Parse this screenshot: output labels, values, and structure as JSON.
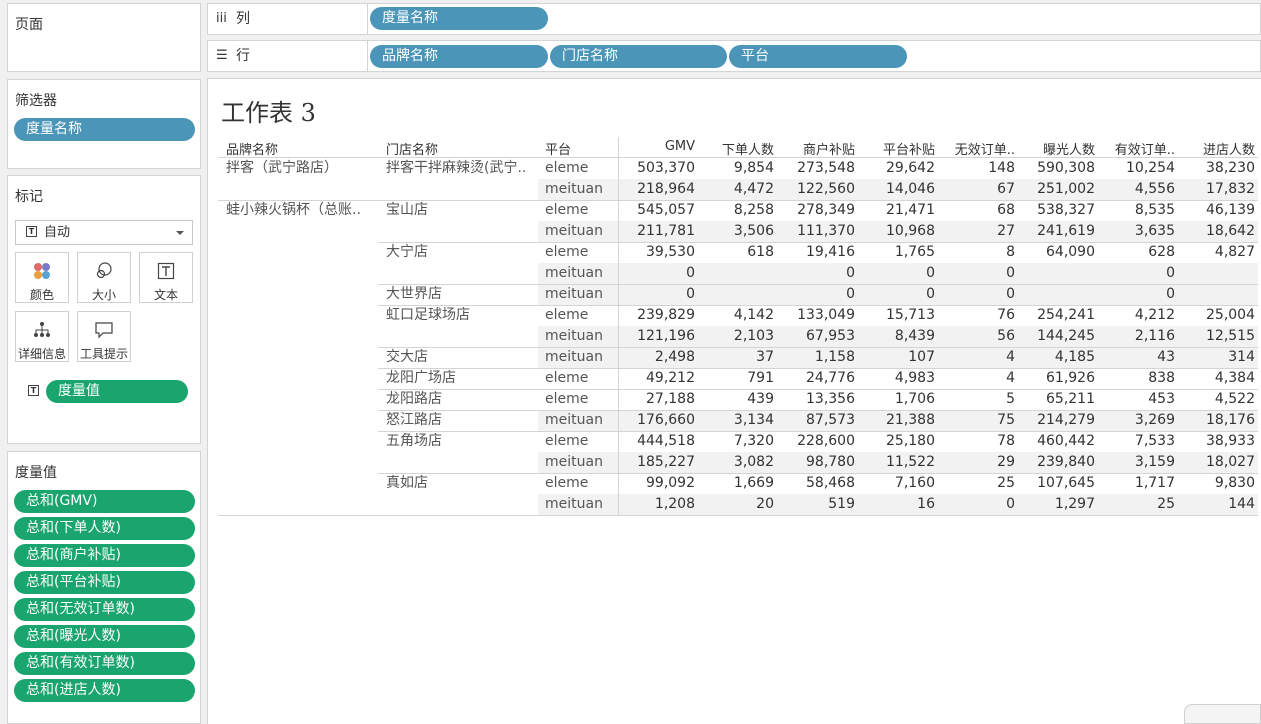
{
  "pages": {
    "title": "页面"
  },
  "filters": {
    "title": "筛选器",
    "pill": "度量名称"
  },
  "marks": {
    "title": "标记",
    "mark_type": "自动",
    "buttons": [
      "颜色",
      "大小",
      "文本",
      "详细信息",
      "工具提示"
    ],
    "text_pill": "度量值"
  },
  "measure_values": {
    "title": "度量值",
    "items": [
      "总和(GMV)",
      "总和(下单人数)",
      "总和(商户补贴)",
      "总和(平台补贴)",
      "总和(无效订单数)",
      "总和(曝光人数)",
      "总和(有效订单数)",
      "总和(进店人数)"
    ]
  },
  "shelves": {
    "columns_label": "列",
    "columns_pills": [
      "度量名称"
    ],
    "rows_label": "行",
    "rows_pills": [
      "品牌名称",
      "门店名称",
      "平台"
    ]
  },
  "sheet": {
    "title": "工作表 3",
    "row_headers": [
      "品牌名称",
      "门店名称",
      "平台"
    ],
    "measure_headers": [
      "GMV",
      "下单人数",
      "商户补贴",
      "平台补贴",
      "无效订单..",
      "曝光人数",
      "有效订单..",
      "进店人数"
    ],
    "rows": [
      {
        "brand": "拌客（武宁路店）",
        "store": "拌客干拌麻辣烫(武宁..",
        "platform": "eleme",
        "v": [
          "503,370",
          "9,854",
          "273,548",
          "29,642",
          "148",
          "590,308",
          "10,254",
          "38,230"
        ]
      },
      {
        "brand": "",
        "store": "",
        "platform": "meituan",
        "v": [
          "218,964",
          "4,472",
          "122,560",
          "14,046",
          "67",
          "251,002",
          "4,556",
          "17,832"
        ]
      },
      {
        "brand": "蛙小辣火锅杯（总账..",
        "store": "宝山店",
        "platform": "eleme",
        "v": [
          "545,057",
          "8,258",
          "278,349",
          "21,471",
          "68",
          "538,327",
          "8,535",
          "46,139"
        ]
      },
      {
        "brand": "",
        "store": "",
        "platform": "meituan",
        "v": [
          "211,781",
          "3,506",
          "111,370",
          "10,968",
          "27",
          "241,619",
          "3,635",
          "18,642"
        ]
      },
      {
        "brand": "",
        "store": "大宁店",
        "platform": "eleme",
        "v": [
          "39,530",
          "618",
          "19,416",
          "1,765",
          "8",
          "64,090",
          "628",
          "4,827"
        ]
      },
      {
        "brand": "",
        "store": "",
        "platform": "meituan",
        "v": [
          "0",
          "",
          "0",
          "0",
          "0",
          "",
          "0",
          ""
        ]
      },
      {
        "brand": "",
        "store": "大世界店",
        "platform": "meituan",
        "v": [
          "0",
          "",
          "0",
          "0",
          "0",
          "",
          "0",
          ""
        ]
      },
      {
        "brand": "",
        "store": "虹口足球场店",
        "platform": "eleme",
        "v": [
          "239,829",
          "4,142",
          "133,049",
          "15,713",
          "76",
          "254,241",
          "4,212",
          "25,004"
        ]
      },
      {
        "brand": "",
        "store": "",
        "platform": "meituan",
        "v": [
          "121,196",
          "2,103",
          "67,953",
          "8,439",
          "56",
          "144,245",
          "2,116",
          "12,515"
        ]
      },
      {
        "brand": "",
        "store": "交大店",
        "platform": "meituan",
        "v": [
          "2,498",
          "37",
          "1,158",
          "107",
          "4",
          "4,185",
          "43",
          "314"
        ]
      },
      {
        "brand": "",
        "store": "龙阳广场店",
        "platform": "eleme",
        "v": [
          "49,212",
          "791",
          "24,776",
          "4,983",
          "4",
          "61,926",
          "838",
          "4,384"
        ]
      },
      {
        "brand": "",
        "store": "龙阳路店",
        "platform": "eleme",
        "v": [
          "27,188",
          "439",
          "13,356",
          "1,706",
          "5",
          "65,211",
          "453",
          "4,522"
        ]
      },
      {
        "brand": "",
        "store": "怒江路店",
        "platform": "meituan",
        "v": [
          "176,660",
          "3,134",
          "87,573",
          "21,388",
          "75",
          "214,279",
          "3,269",
          "18,176"
        ]
      },
      {
        "brand": "",
        "store": "五角场店",
        "platform": "eleme",
        "v": [
          "444,518",
          "7,320",
          "228,600",
          "25,180",
          "78",
          "460,442",
          "7,533",
          "38,933"
        ]
      },
      {
        "brand": "",
        "store": "",
        "platform": "meituan",
        "v": [
          "185,227",
          "3,082",
          "98,780",
          "11,522",
          "29",
          "239,840",
          "3,159",
          "18,027"
        ]
      },
      {
        "brand": "",
        "store": "真如店",
        "platform": "eleme",
        "v": [
          "99,092",
          "1,669",
          "58,468",
          "7,160",
          "25",
          "107,645",
          "1,717",
          "9,830"
        ]
      },
      {
        "brand": "",
        "store": "",
        "platform": "meituan",
        "v": [
          "1,208",
          "20",
          "519",
          "16",
          "0",
          "1,297",
          "25",
          "144"
        ]
      }
    ]
  },
  "colors": {
    "blue_pill": "#4b96b8",
    "green_pill": "#1aa56e",
    "band": "#f2f2f2",
    "border": "#d4d4d4"
  }
}
